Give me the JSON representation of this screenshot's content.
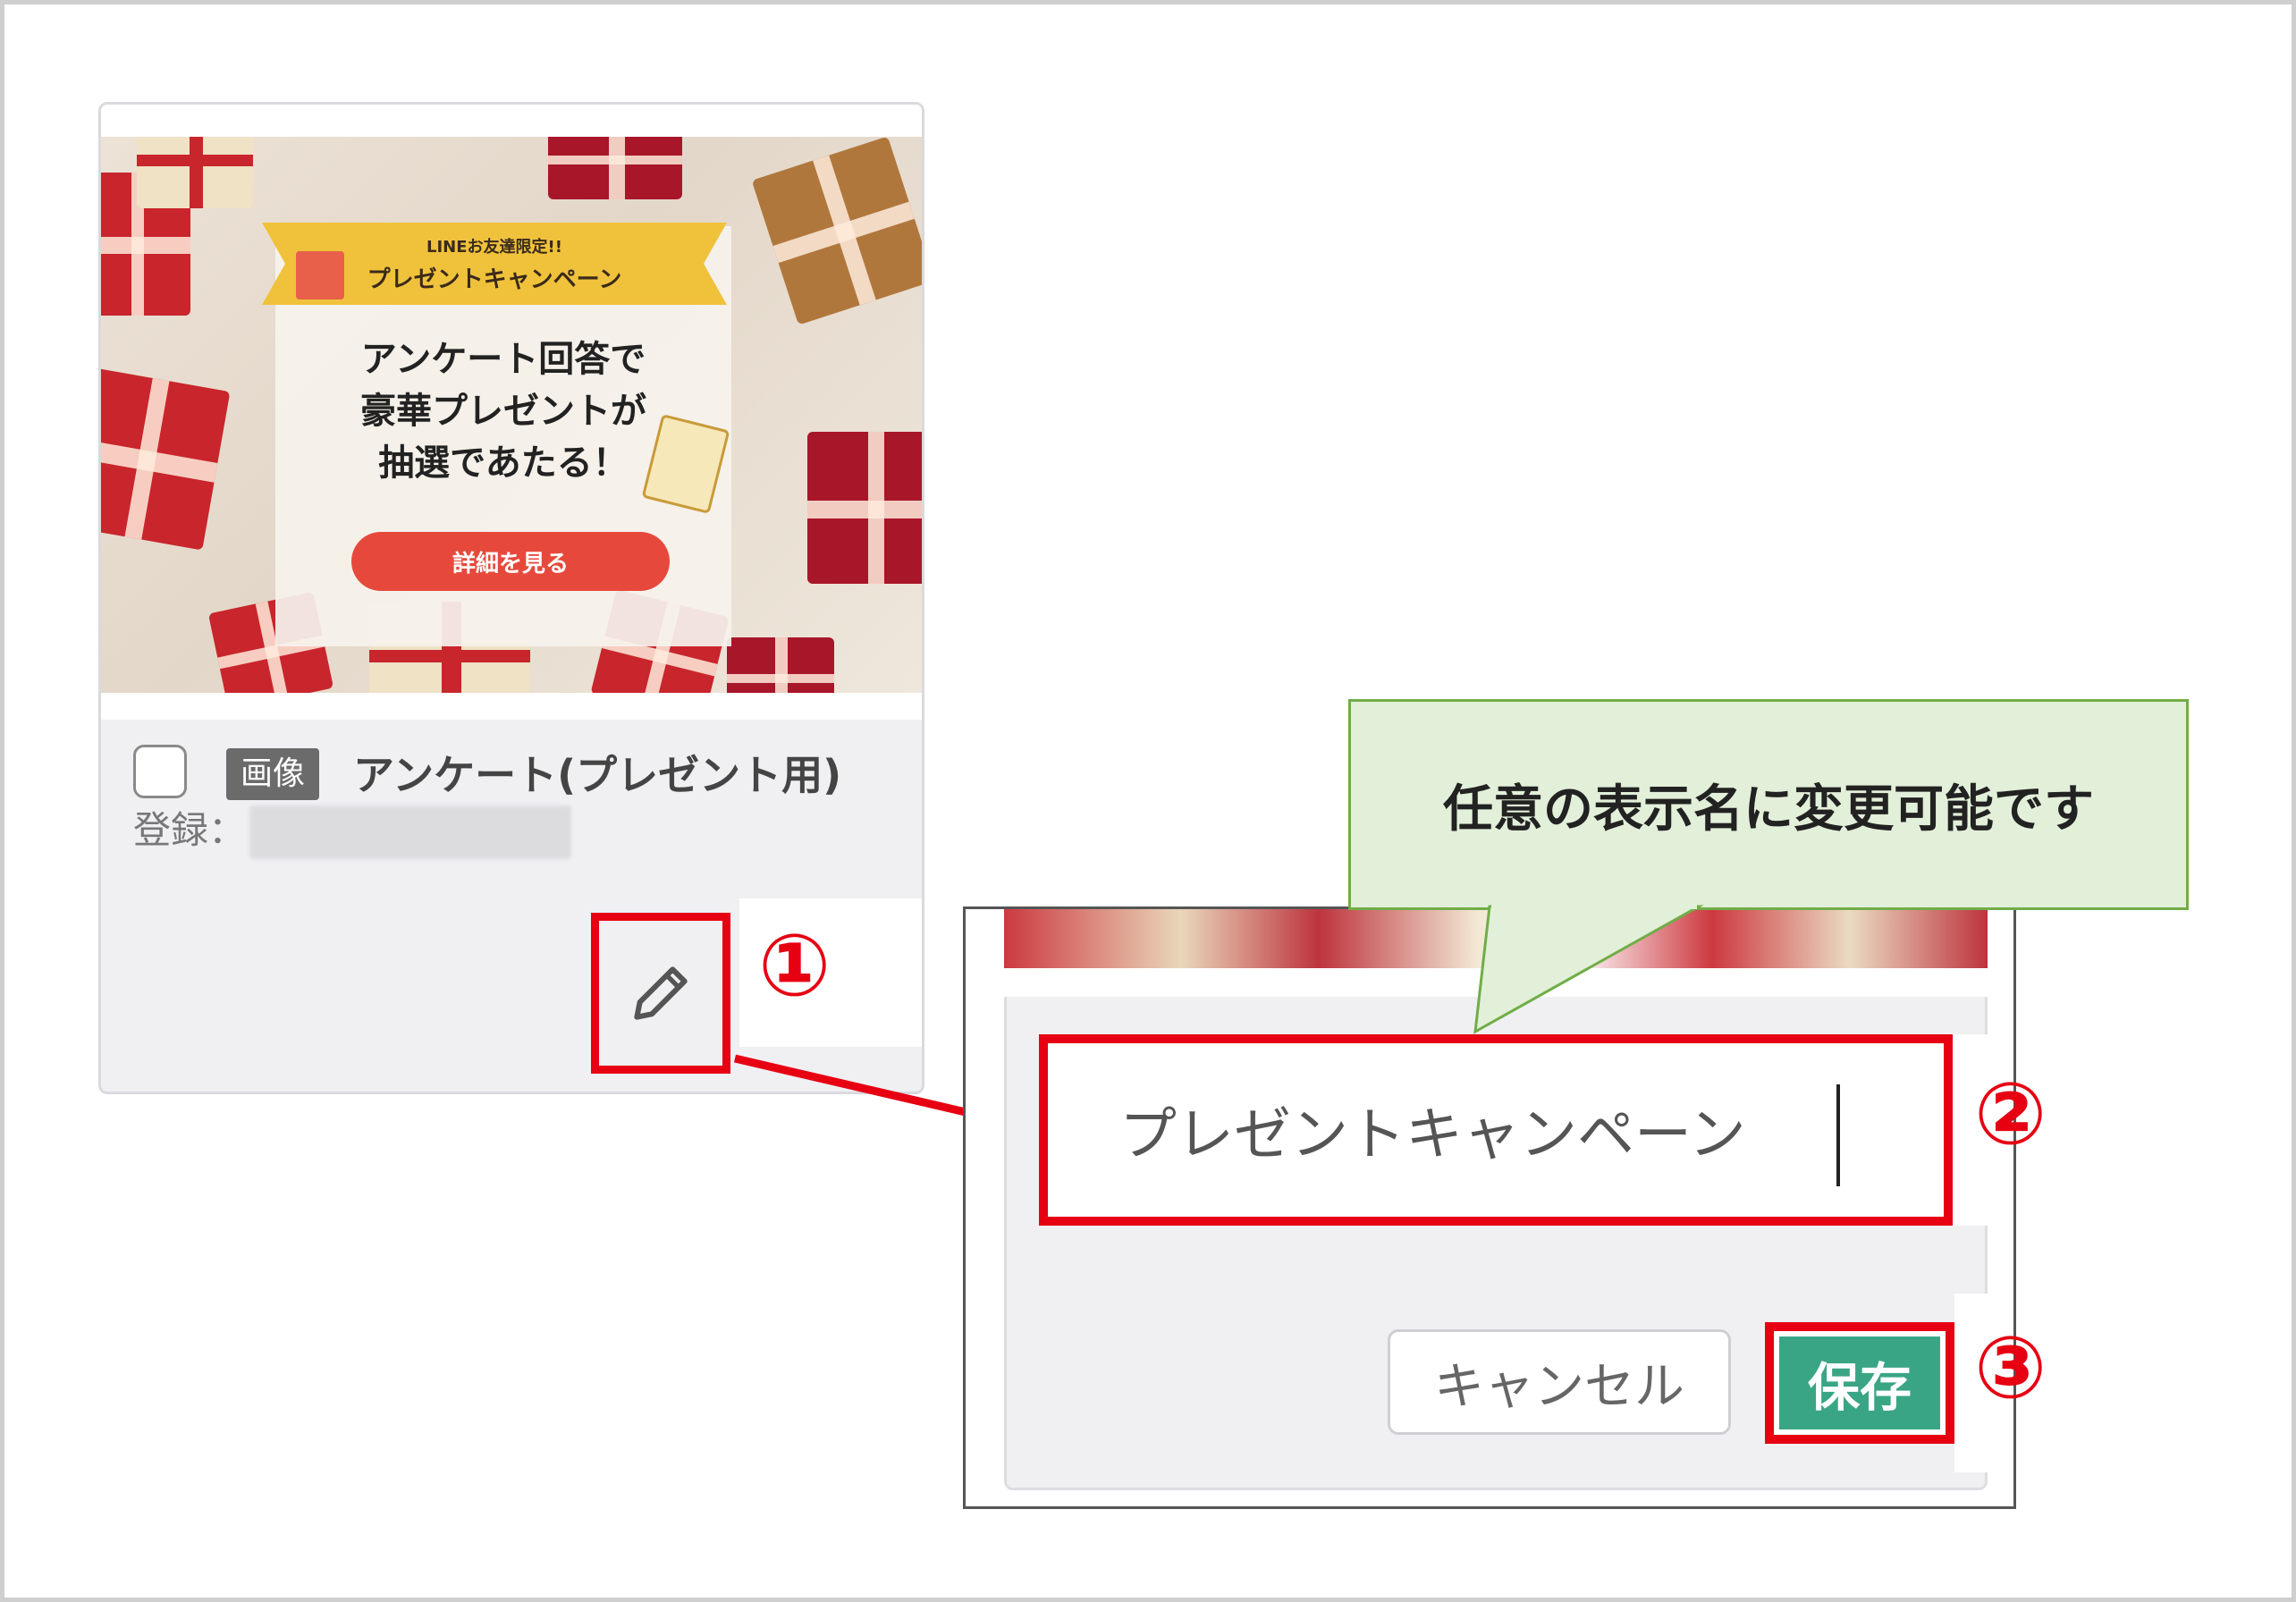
{
  "card": {
    "thumbnail": {
      "ribbon_small": "LINEお友達限定!!",
      "ribbon_big": "プレゼントキャンペーン",
      "headline_lines": [
        "アンケート回答で",
        "豪華プレゼントが",
        "抽選であたる！"
      ],
      "detail_button": "詳細を見る"
    },
    "type_badge": "画像",
    "title": "アンケート(プレゼント用)",
    "registered_label": "登録："
  },
  "steps": {
    "step1": "①",
    "step2": "②",
    "step3": "③"
  },
  "callout": {
    "text": "任意の表示名に変更可能です"
  },
  "edit_form": {
    "name_value": "プレゼントキャンペーン",
    "cancel_label": "キャンセル",
    "save_label": "保存"
  },
  "colors": {
    "highlight": "#e60012",
    "save_button": "#3aa585",
    "callout_fill": "#e2efd9",
    "callout_border": "#70ad47"
  }
}
